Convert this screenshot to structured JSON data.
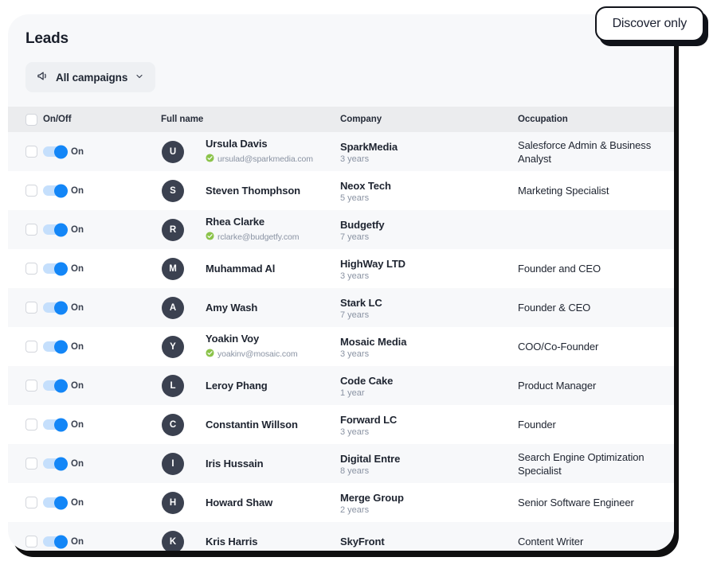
{
  "card": {
    "title": "Leads",
    "campaign_filter": {
      "label": "All campaigns",
      "megaphone_icon": "megaphone-icon",
      "chevron_icon": "chevron-down-icon"
    }
  },
  "badge": {
    "label": "Discover only"
  },
  "table": {
    "columns": [
      "On/Off",
      "Full name",
      "Company",
      "Occupation"
    ],
    "toggle_on_label": "On",
    "rows": [
      {
        "initial": "U",
        "name": "Ursula Davis",
        "email": "ursulad@sparkmedia.com",
        "verified": true,
        "company": "SparkMedia",
        "years": "3 years",
        "occupation": "Salesforce Admin & Business Analyst",
        "toggle": "On"
      },
      {
        "initial": "S",
        "name": "Steven Thomphson",
        "email": "",
        "verified": false,
        "company": "Neox Tech",
        "years": "5 years",
        "occupation": "Marketing Specialist",
        "toggle": "On"
      },
      {
        "initial": "R",
        "name": "Rhea Clarke",
        "email": "rclarke@budgetfy.com",
        "verified": true,
        "company": "Budgetfy",
        "years": "7 years",
        "occupation": "",
        "toggle": "On"
      },
      {
        "initial": "M",
        "name": "Muhammad Al",
        "email": "",
        "verified": false,
        "company": "HighWay LTD",
        "years": "3 years",
        "occupation": "Founder and CEO",
        "toggle": "On"
      },
      {
        "initial": "A",
        "name": "Amy Wash",
        "email": "",
        "verified": false,
        "company": "Stark LC",
        "years": "7 years",
        "occupation": "Founder & CEO",
        "toggle": "On"
      },
      {
        "initial": "Y",
        "name": "Yoakin Voy",
        "email": "yoakinv@mosaic.com",
        "verified": true,
        "company": "Mosaic Media",
        "years": "3 years",
        "occupation": "COO/Co-Founder",
        "toggle": "On"
      },
      {
        "initial": "L",
        "name": "Leroy Phang",
        "email": "",
        "verified": false,
        "company": "Code Cake",
        "years": "1 year",
        "occupation": "Product Manager",
        "toggle": "On"
      },
      {
        "initial": "C",
        "name": "Constantin Willson",
        "email": "",
        "verified": false,
        "company": "Forward LC",
        "years": "3 years",
        "occupation": "Founder",
        "toggle": "On"
      },
      {
        "initial": "I",
        "name": "Iris Hussain",
        "email": "",
        "verified": false,
        "company": "Digital Entre",
        "years": "8 years",
        "occupation": "Search Engine Optimization Specialist",
        "toggle": "On"
      },
      {
        "initial": "H",
        "name": "Howard Shaw",
        "email": "",
        "verified": false,
        "company": "Merge Group",
        "years": "2 years",
        "occupation": "Senior Software Engineer",
        "toggle": "On"
      },
      {
        "initial": "K",
        "name": "Kris Harris",
        "email": "",
        "verified": false,
        "company": "SkyFront",
        "years": "",
        "occupation": "Content Writer",
        "toggle": "On"
      }
    ]
  },
  "colors": {
    "accent_blue": "#1386f7",
    "toggle_track": "#c5dffc",
    "avatar_bg": "#3b4150",
    "verified_green": "#8bc34a",
    "row_alt": "#f7f8fa",
    "header_bg": "#ebecee",
    "card_shadow": "#0f0f10"
  }
}
